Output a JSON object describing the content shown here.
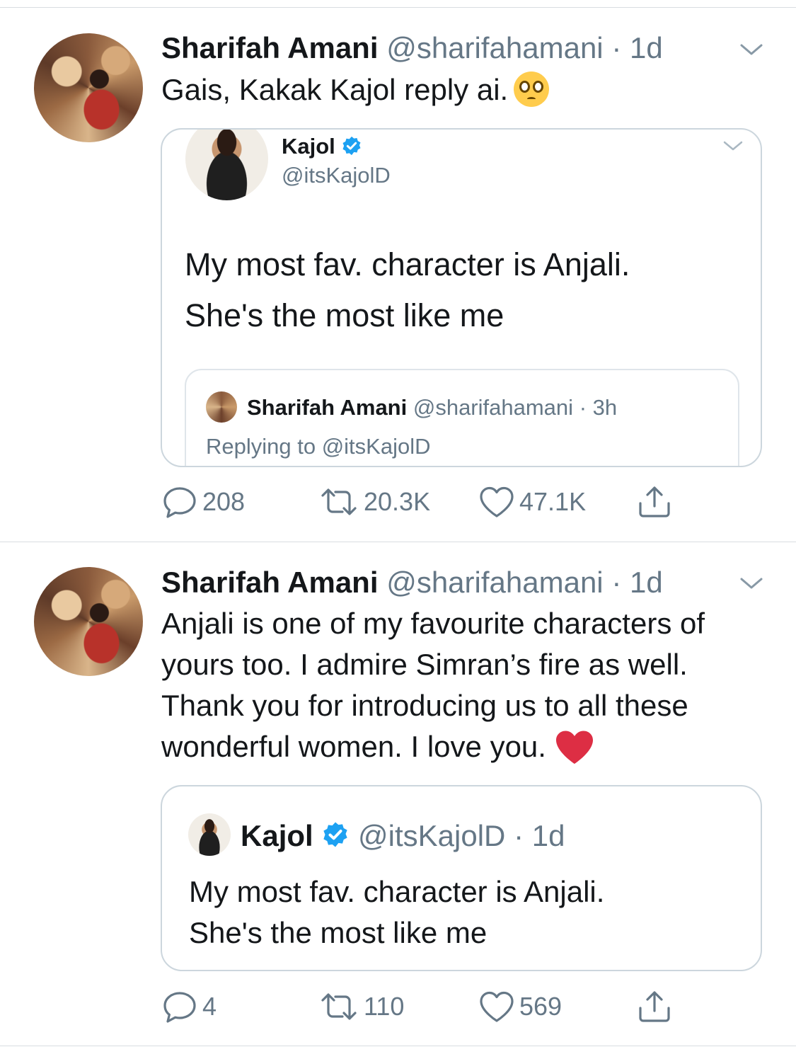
{
  "tweets": [
    {
      "author_name": "Sharifah Amani",
      "author_handle": "@sharifahamani",
      "time": "· 1d",
      "text": "Gais, Kakak Kajol reply ai.",
      "emoji": "pleading-face",
      "quoted": {
        "name": "Kajol",
        "verified": true,
        "handle": "@itsKajolD",
        "text_line1": "My most fav. character is Anjali.",
        "text_line2": "She's the most like me",
        "nested_reply": {
          "name": "Sharifah Amani",
          "handle": "@sharifahamani",
          "time": "· 3h",
          "replying_to": "Replying to @itsKajolD"
        }
      },
      "actions": {
        "replies": "208",
        "retweets": "20.3K",
        "likes": "47.1K"
      }
    },
    {
      "author_name": "Sharifah Amani",
      "author_handle": "@sharifahamani",
      "time": "· 1d",
      "text_lines": [
        "Anjali is one of my favourite characters of",
        "yours too. I admire Simran’s fire as well.",
        "Thank you for introducing us to all these",
        "wonderful women. I love you."
      ],
      "emoji": "red-heart",
      "quoted": {
        "name": "Kajol",
        "verified": true,
        "handle": "@itsKajolD",
        "time": "· 1d",
        "text_line1": "My most fav. character is Anjali.",
        "text_line2": "She's the most like me"
      },
      "actions": {
        "replies": "4",
        "retweets": "110",
        "likes": "569"
      }
    }
  ],
  "colors": {
    "text": "#14171a",
    "secondary": "#657786",
    "verified": "#1da1f2",
    "border": "#ccd6dd"
  }
}
